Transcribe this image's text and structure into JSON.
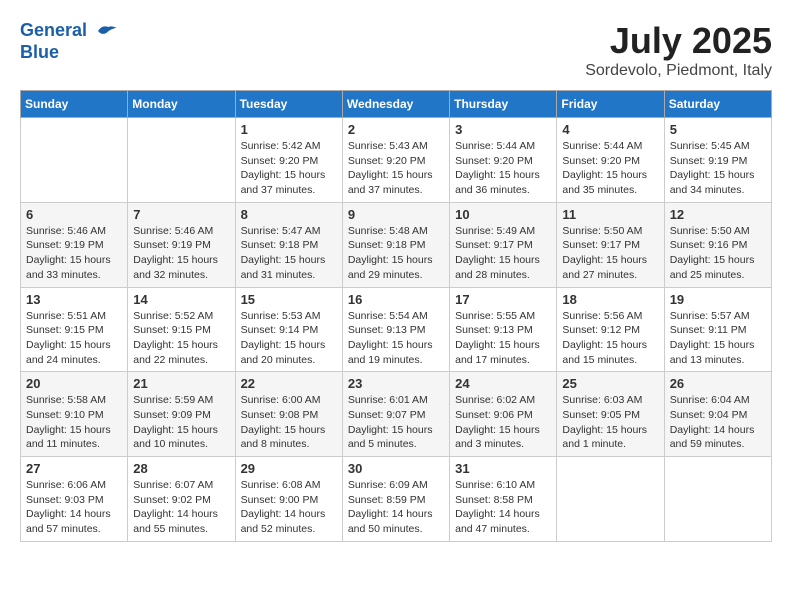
{
  "header": {
    "logo_line1": "General",
    "logo_line2": "Blue",
    "month": "July 2025",
    "location": "Sordevolo, Piedmont, Italy"
  },
  "days_of_week": [
    "Sunday",
    "Monday",
    "Tuesday",
    "Wednesday",
    "Thursday",
    "Friday",
    "Saturday"
  ],
  "weeks": [
    [
      {
        "day": "",
        "sunrise": "",
        "sunset": "",
        "daylight": ""
      },
      {
        "day": "",
        "sunrise": "",
        "sunset": "",
        "daylight": ""
      },
      {
        "day": "1",
        "sunrise": "Sunrise: 5:42 AM",
        "sunset": "Sunset: 9:20 PM",
        "daylight": "Daylight: 15 hours and 37 minutes."
      },
      {
        "day": "2",
        "sunrise": "Sunrise: 5:43 AM",
        "sunset": "Sunset: 9:20 PM",
        "daylight": "Daylight: 15 hours and 37 minutes."
      },
      {
        "day": "3",
        "sunrise": "Sunrise: 5:44 AM",
        "sunset": "Sunset: 9:20 PM",
        "daylight": "Daylight: 15 hours and 36 minutes."
      },
      {
        "day": "4",
        "sunrise": "Sunrise: 5:44 AM",
        "sunset": "Sunset: 9:20 PM",
        "daylight": "Daylight: 15 hours and 35 minutes."
      },
      {
        "day": "5",
        "sunrise": "Sunrise: 5:45 AM",
        "sunset": "Sunset: 9:19 PM",
        "daylight": "Daylight: 15 hours and 34 minutes."
      }
    ],
    [
      {
        "day": "6",
        "sunrise": "Sunrise: 5:46 AM",
        "sunset": "Sunset: 9:19 PM",
        "daylight": "Daylight: 15 hours and 33 minutes."
      },
      {
        "day": "7",
        "sunrise": "Sunrise: 5:46 AM",
        "sunset": "Sunset: 9:19 PM",
        "daylight": "Daylight: 15 hours and 32 minutes."
      },
      {
        "day": "8",
        "sunrise": "Sunrise: 5:47 AM",
        "sunset": "Sunset: 9:18 PM",
        "daylight": "Daylight: 15 hours and 31 minutes."
      },
      {
        "day": "9",
        "sunrise": "Sunrise: 5:48 AM",
        "sunset": "Sunset: 9:18 PM",
        "daylight": "Daylight: 15 hours and 29 minutes."
      },
      {
        "day": "10",
        "sunrise": "Sunrise: 5:49 AM",
        "sunset": "Sunset: 9:17 PM",
        "daylight": "Daylight: 15 hours and 28 minutes."
      },
      {
        "day": "11",
        "sunrise": "Sunrise: 5:50 AM",
        "sunset": "Sunset: 9:17 PM",
        "daylight": "Daylight: 15 hours and 27 minutes."
      },
      {
        "day": "12",
        "sunrise": "Sunrise: 5:50 AM",
        "sunset": "Sunset: 9:16 PM",
        "daylight": "Daylight: 15 hours and 25 minutes."
      }
    ],
    [
      {
        "day": "13",
        "sunrise": "Sunrise: 5:51 AM",
        "sunset": "Sunset: 9:15 PM",
        "daylight": "Daylight: 15 hours and 24 minutes."
      },
      {
        "day": "14",
        "sunrise": "Sunrise: 5:52 AM",
        "sunset": "Sunset: 9:15 PM",
        "daylight": "Daylight: 15 hours and 22 minutes."
      },
      {
        "day": "15",
        "sunrise": "Sunrise: 5:53 AM",
        "sunset": "Sunset: 9:14 PM",
        "daylight": "Daylight: 15 hours and 20 minutes."
      },
      {
        "day": "16",
        "sunrise": "Sunrise: 5:54 AM",
        "sunset": "Sunset: 9:13 PM",
        "daylight": "Daylight: 15 hours and 19 minutes."
      },
      {
        "day": "17",
        "sunrise": "Sunrise: 5:55 AM",
        "sunset": "Sunset: 9:13 PM",
        "daylight": "Daylight: 15 hours and 17 minutes."
      },
      {
        "day": "18",
        "sunrise": "Sunrise: 5:56 AM",
        "sunset": "Sunset: 9:12 PM",
        "daylight": "Daylight: 15 hours and 15 minutes."
      },
      {
        "day": "19",
        "sunrise": "Sunrise: 5:57 AM",
        "sunset": "Sunset: 9:11 PM",
        "daylight": "Daylight: 15 hours and 13 minutes."
      }
    ],
    [
      {
        "day": "20",
        "sunrise": "Sunrise: 5:58 AM",
        "sunset": "Sunset: 9:10 PM",
        "daylight": "Daylight: 15 hours and 11 minutes."
      },
      {
        "day": "21",
        "sunrise": "Sunrise: 5:59 AM",
        "sunset": "Sunset: 9:09 PM",
        "daylight": "Daylight: 15 hours and 10 minutes."
      },
      {
        "day": "22",
        "sunrise": "Sunrise: 6:00 AM",
        "sunset": "Sunset: 9:08 PM",
        "daylight": "Daylight: 15 hours and 8 minutes."
      },
      {
        "day": "23",
        "sunrise": "Sunrise: 6:01 AM",
        "sunset": "Sunset: 9:07 PM",
        "daylight": "Daylight: 15 hours and 5 minutes."
      },
      {
        "day": "24",
        "sunrise": "Sunrise: 6:02 AM",
        "sunset": "Sunset: 9:06 PM",
        "daylight": "Daylight: 15 hours and 3 minutes."
      },
      {
        "day": "25",
        "sunrise": "Sunrise: 6:03 AM",
        "sunset": "Sunset: 9:05 PM",
        "daylight": "Daylight: 15 hours and 1 minute."
      },
      {
        "day": "26",
        "sunrise": "Sunrise: 6:04 AM",
        "sunset": "Sunset: 9:04 PM",
        "daylight": "Daylight: 14 hours and 59 minutes."
      }
    ],
    [
      {
        "day": "27",
        "sunrise": "Sunrise: 6:06 AM",
        "sunset": "Sunset: 9:03 PM",
        "daylight": "Daylight: 14 hours and 57 minutes."
      },
      {
        "day": "28",
        "sunrise": "Sunrise: 6:07 AM",
        "sunset": "Sunset: 9:02 PM",
        "daylight": "Daylight: 14 hours and 55 minutes."
      },
      {
        "day": "29",
        "sunrise": "Sunrise: 6:08 AM",
        "sunset": "Sunset: 9:00 PM",
        "daylight": "Daylight: 14 hours and 52 minutes."
      },
      {
        "day": "30",
        "sunrise": "Sunrise: 6:09 AM",
        "sunset": "Sunset: 8:59 PM",
        "daylight": "Daylight: 14 hours and 50 minutes."
      },
      {
        "day": "31",
        "sunrise": "Sunrise: 6:10 AM",
        "sunset": "Sunset: 8:58 PM",
        "daylight": "Daylight: 14 hours and 47 minutes."
      },
      {
        "day": "",
        "sunrise": "",
        "sunset": "",
        "daylight": ""
      },
      {
        "day": "",
        "sunrise": "",
        "sunset": "",
        "daylight": ""
      }
    ]
  ]
}
